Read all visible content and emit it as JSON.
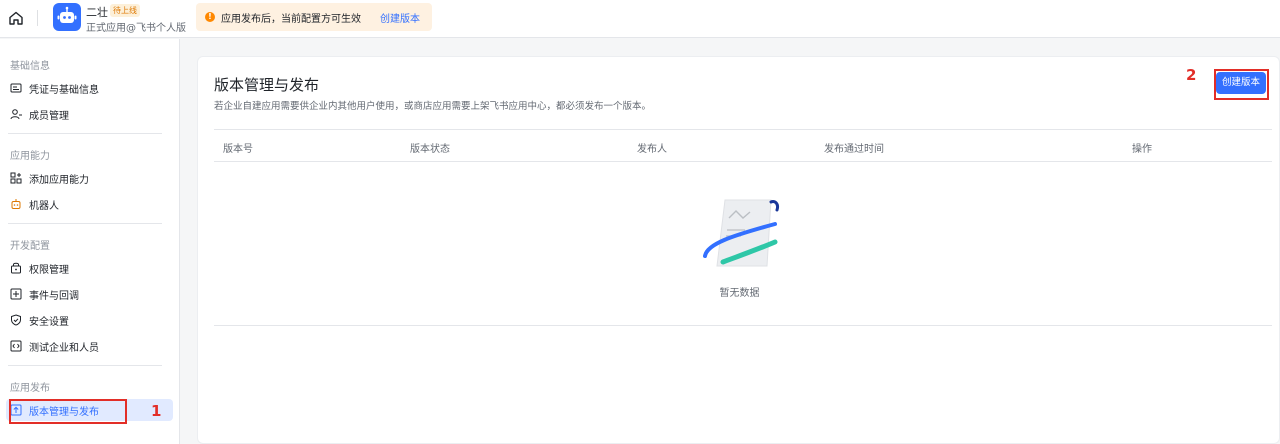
{
  "header": {
    "app_name": "二壮",
    "app_status_badge": "待上线",
    "app_subtitle": "正式应用@飞书个人版",
    "notice_text": "应用发布后，当前配置方可生效",
    "notice_link": "创建版本",
    "notice_icon": "!"
  },
  "sidebar": {
    "groups": [
      {
        "title": "基础信息",
        "items": [
          {
            "label": "凭证与基础信息",
            "icon": "id-card-icon"
          },
          {
            "label": "成员管理",
            "icon": "user-icon"
          }
        ]
      },
      {
        "title": "应用能力",
        "items": [
          {
            "label": "添加应用能力",
            "icon": "apps-add-icon"
          },
          {
            "label": "机器人",
            "icon": "robot-icon"
          }
        ]
      },
      {
        "title": "开发配置",
        "items": [
          {
            "label": "权限管理",
            "icon": "lock-icon"
          },
          {
            "label": "事件与回调",
            "icon": "event-icon"
          },
          {
            "label": "安全设置",
            "icon": "shield-icon"
          },
          {
            "label": "测试企业和人员",
            "icon": "code-icon"
          }
        ]
      },
      {
        "title": "应用发布",
        "items": [
          {
            "label": "版本管理与发布",
            "icon": "upload-icon",
            "active": true
          }
        ]
      }
    ]
  },
  "main": {
    "title": "版本管理与发布",
    "description": "若企业自建应用需要供企业内其他用户使用，或商店应用需要上架飞书应用中心，都必须发布一个版本。",
    "create_button": "创建版本",
    "table_headers": [
      "版本号",
      "版本状态",
      "发布人",
      "发布通过时间",
      "操作"
    ],
    "empty_text": "暂无数据"
  },
  "annotations": {
    "marker1": "1",
    "marker2": "2"
  },
  "colors": {
    "accent": "#3370ff",
    "highlight": "#e22e28",
    "notice_bg": "#fef1e1"
  }
}
